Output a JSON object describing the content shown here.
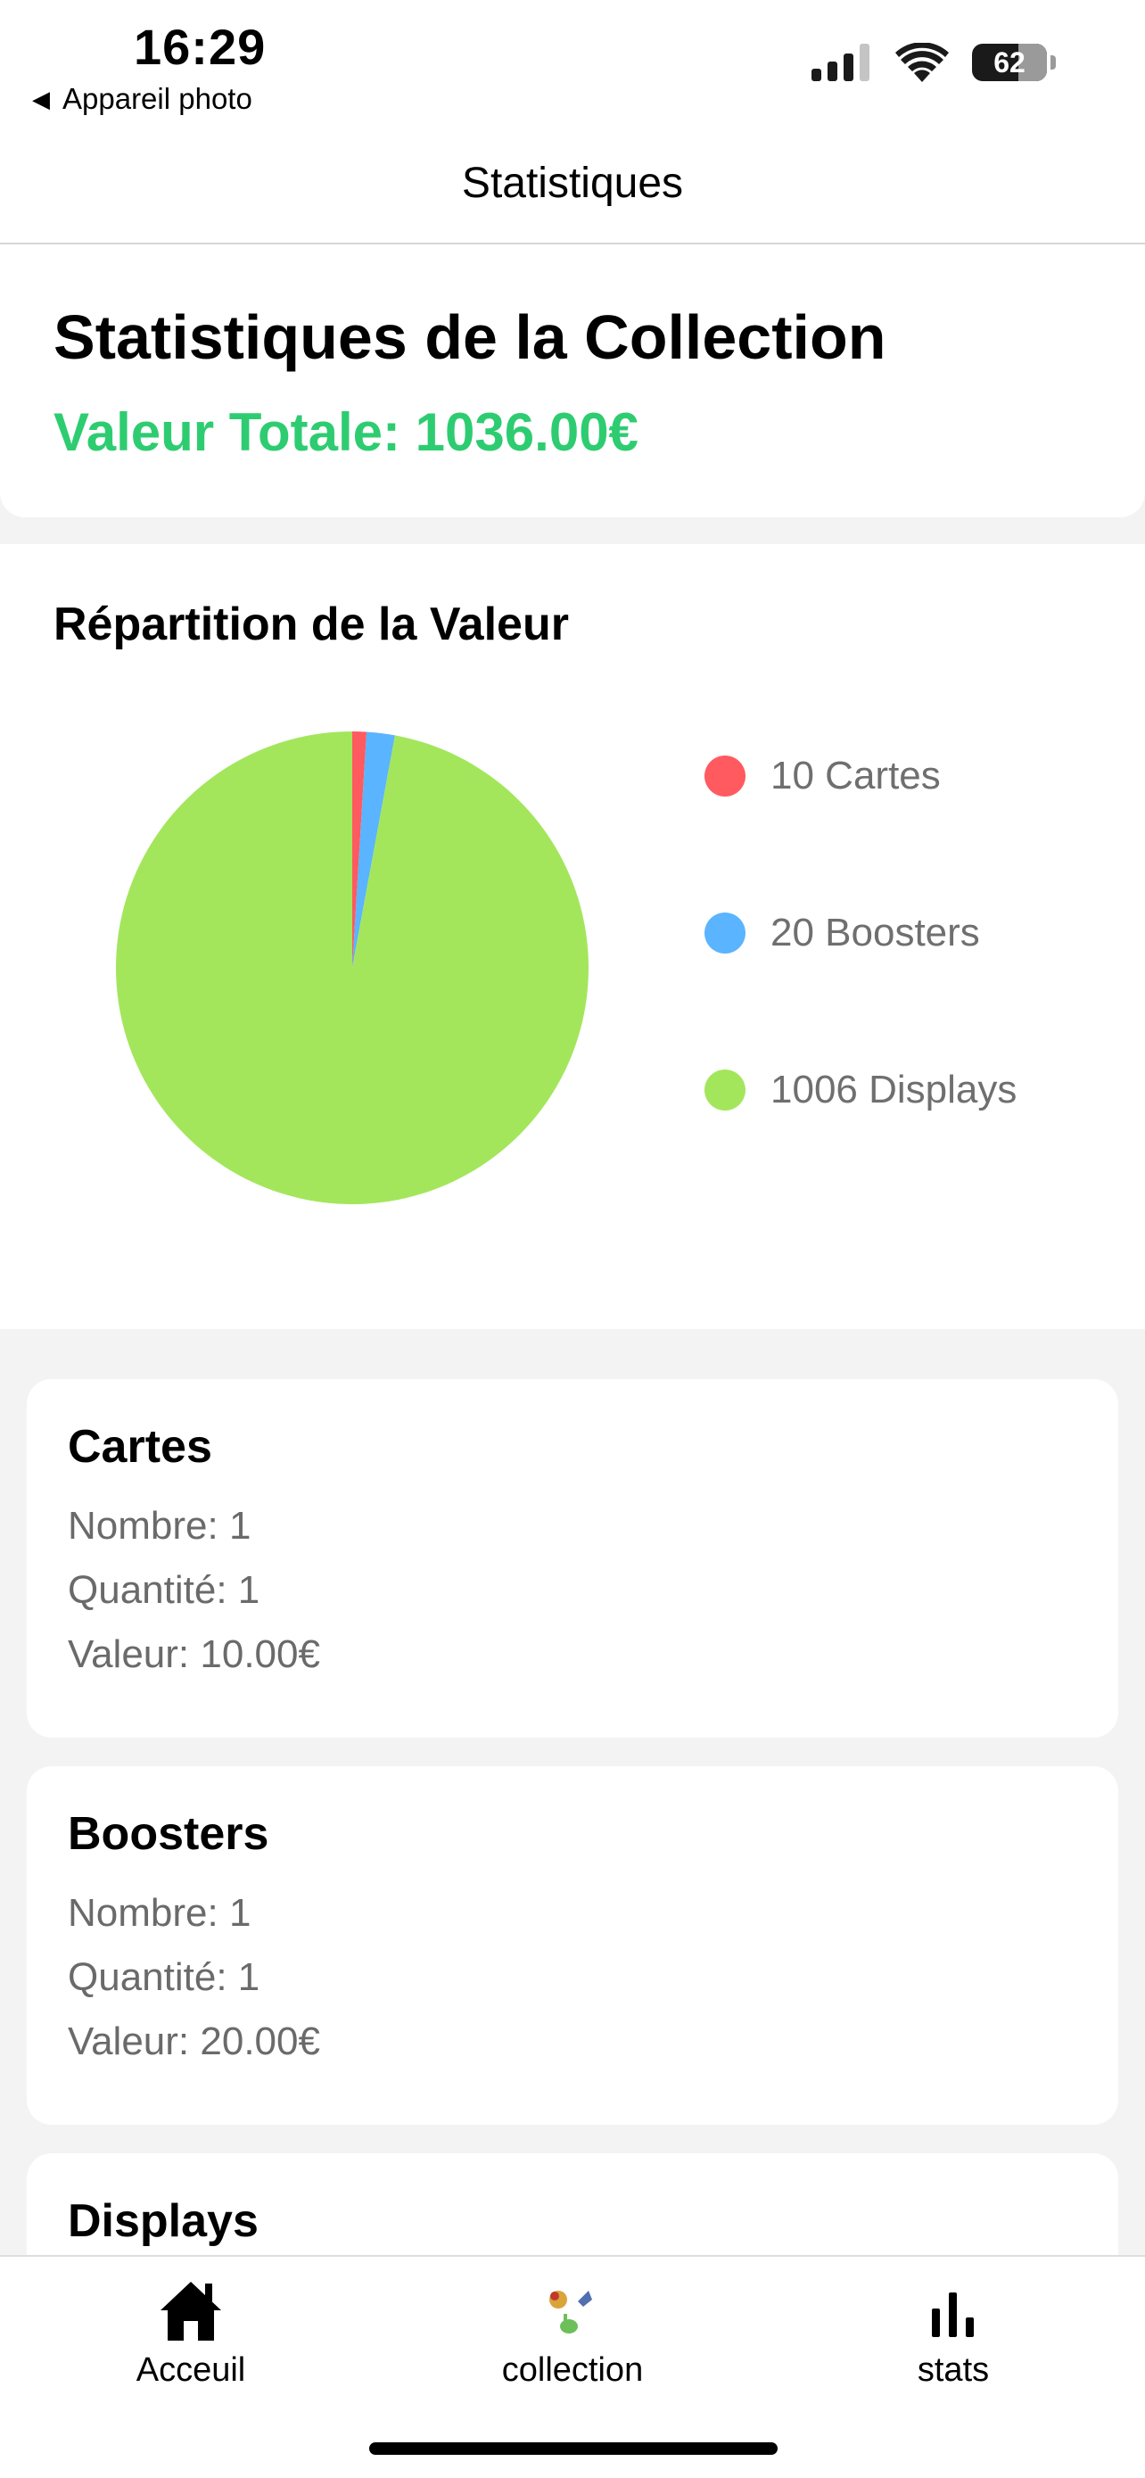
{
  "status_bar": {
    "time": "16:29",
    "back_app": "Appareil photo",
    "battery": "62"
  },
  "nav": {
    "title": "Statistiques"
  },
  "summary": {
    "title": "Statistiques de la Collection",
    "total": "Valeur Totale: 1036.00€",
    "total_color": "#2ecc71"
  },
  "chart": {
    "title": "Répartition de la Valeur",
    "legend": [
      {
        "label": "10 Cartes",
        "color": "#ff5a5f"
      },
      {
        "label": "20 Boosters",
        "color": "#5ab4ff"
      },
      {
        "label": "1006 Displays",
        "color": "#a3e65c"
      }
    ]
  },
  "chart_data": {
    "type": "pie",
    "categories": [
      "Cartes",
      "Boosters",
      "Displays"
    ],
    "values": [
      10,
      20,
      1006
    ],
    "colors": [
      "#ff5a5f",
      "#5ab4ff",
      "#a3e65c"
    ],
    "legend_position": "right"
  },
  "cards": [
    {
      "title": "Cartes",
      "nombre": "Nombre: 1",
      "quantite": "Quantité: 1",
      "valeur": "Valeur: 10.00€"
    },
    {
      "title": "Boosters",
      "nombre": "Nombre: 1",
      "quantite": "Quantité: 1",
      "valeur": "Valeur: 20.00€"
    },
    {
      "title": "Displays"
    }
  ],
  "tabs": [
    {
      "label": "Acceuil",
      "icon": "home-icon"
    },
    {
      "label": "collection",
      "icon": "collection-icon"
    },
    {
      "label": "stats",
      "icon": "bar-chart-icon"
    }
  ]
}
